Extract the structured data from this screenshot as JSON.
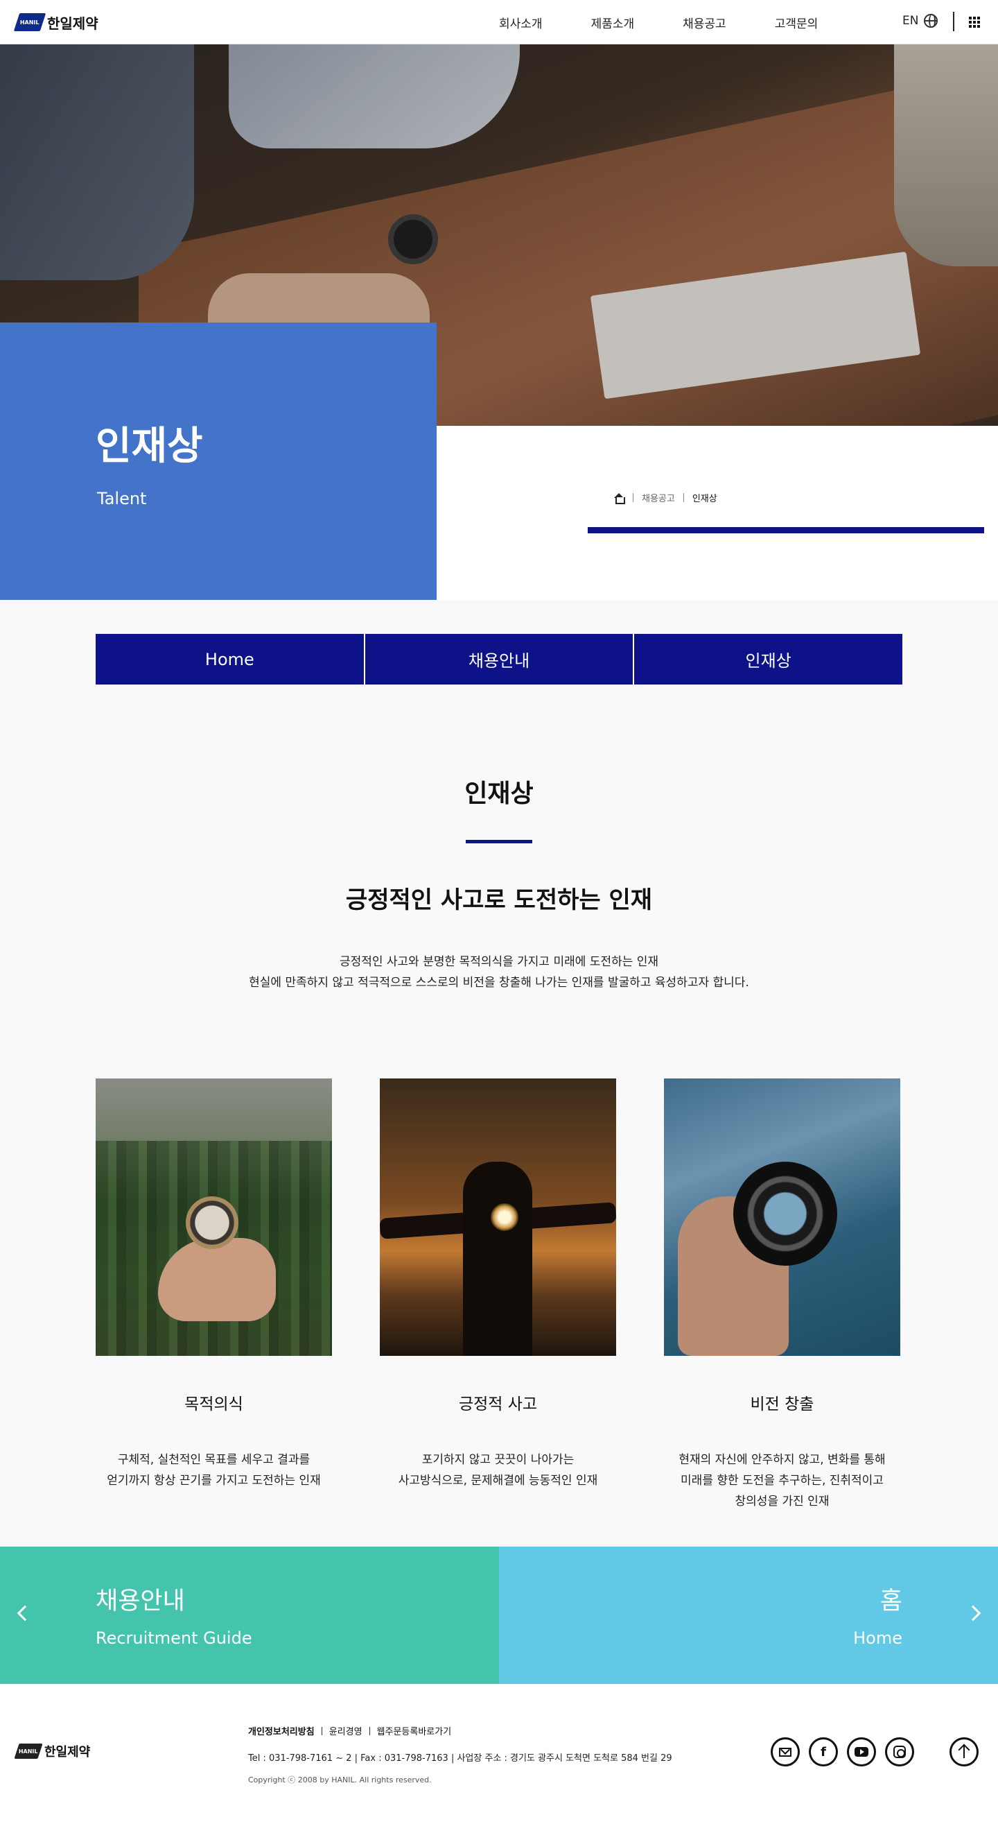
{
  "header": {
    "logo_mark": "HANIL",
    "logo_text": "한일제약",
    "nav": [
      "회사소개",
      "제품소개",
      "채용공고",
      "고객문의"
    ],
    "lang": "EN"
  },
  "hero": {
    "title": "인재상",
    "subtitle": "Talent",
    "breadcrumb": [
      "채용공고",
      "인재상"
    ]
  },
  "tabs": [
    "Home",
    "채용안내",
    "인재상"
  ],
  "section": {
    "title": "인재상",
    "headline": "긍정적인 사고로 도전하는 인재",
    "desc_line1": "긍정적인 사고와 분명한 목적의식을 가지고 미래에 도전하는 인재",
    "desc_line2": "현실에 만족하지 않고 적극적으로 스스로의 비전을 창출해 나가는 인재를 발굴하고 육성하고자 합니다."
  },
  "cards": [
    {
      "title": "목적의식",
      "line1": "구체적, 실천적인 목표를 세우고 결과를",
      "line2": "얻기까지 항상 끈기를 가지고 도전하는 인재",
      "line3": ""
    },
    {
      "title": "긍정적 사고",
      "line1": "포기하지 않고 끗끗이 나아가는",
      "line2": "사고방식으로, 문제해결에 능동적인 인재",
      "line3": ""
    },
    {
      "title": "비전 창출",
      "line1": "현재의 자신에 안주하지 않고, 변화를 통해",
      "line2": "미래를 향한 도전을 추구하는, 진취적이고",
      "line3": "창의성을 가진 인재"
    }
  ],
  "banners": {
    "left": {
      "title": "채용안내",
      "subtitle": "Recruitment Guide",
      "color": "#44c4ad"
    },
    "right": {
      "title": "홈",
      "subtitle": "Home",
      "color": "#61c8e6"
    }
  },
  "footer": {
    "logo_text": "한일제약",
    "links": [
      "개인정보처리방침",
      "윤리경영",
      "웹주문등록바로가기"
    ],
    "info": "Tel : 031-798-7161 ~ 2  |  Fax : 031-798-7163  |  사업장 주소 : 경기도 광주시 도척면 도척로 584 번길 29",
    "copyright": "Copyright ⓒ 2008 by HANIL. All rights reserved.",
    "social": [
      "mail-icon",
      "facebook-icon",
      "youtube-icon",
      "instagram-icon"
    ]
  },
  "colors": {
    "primary_navy": "#0d1289",
    "title_box_blue": "#4474c9",
    "banner_green": "#44c4ad",
    "banner_sky": "#61c8e6"
  }
}
